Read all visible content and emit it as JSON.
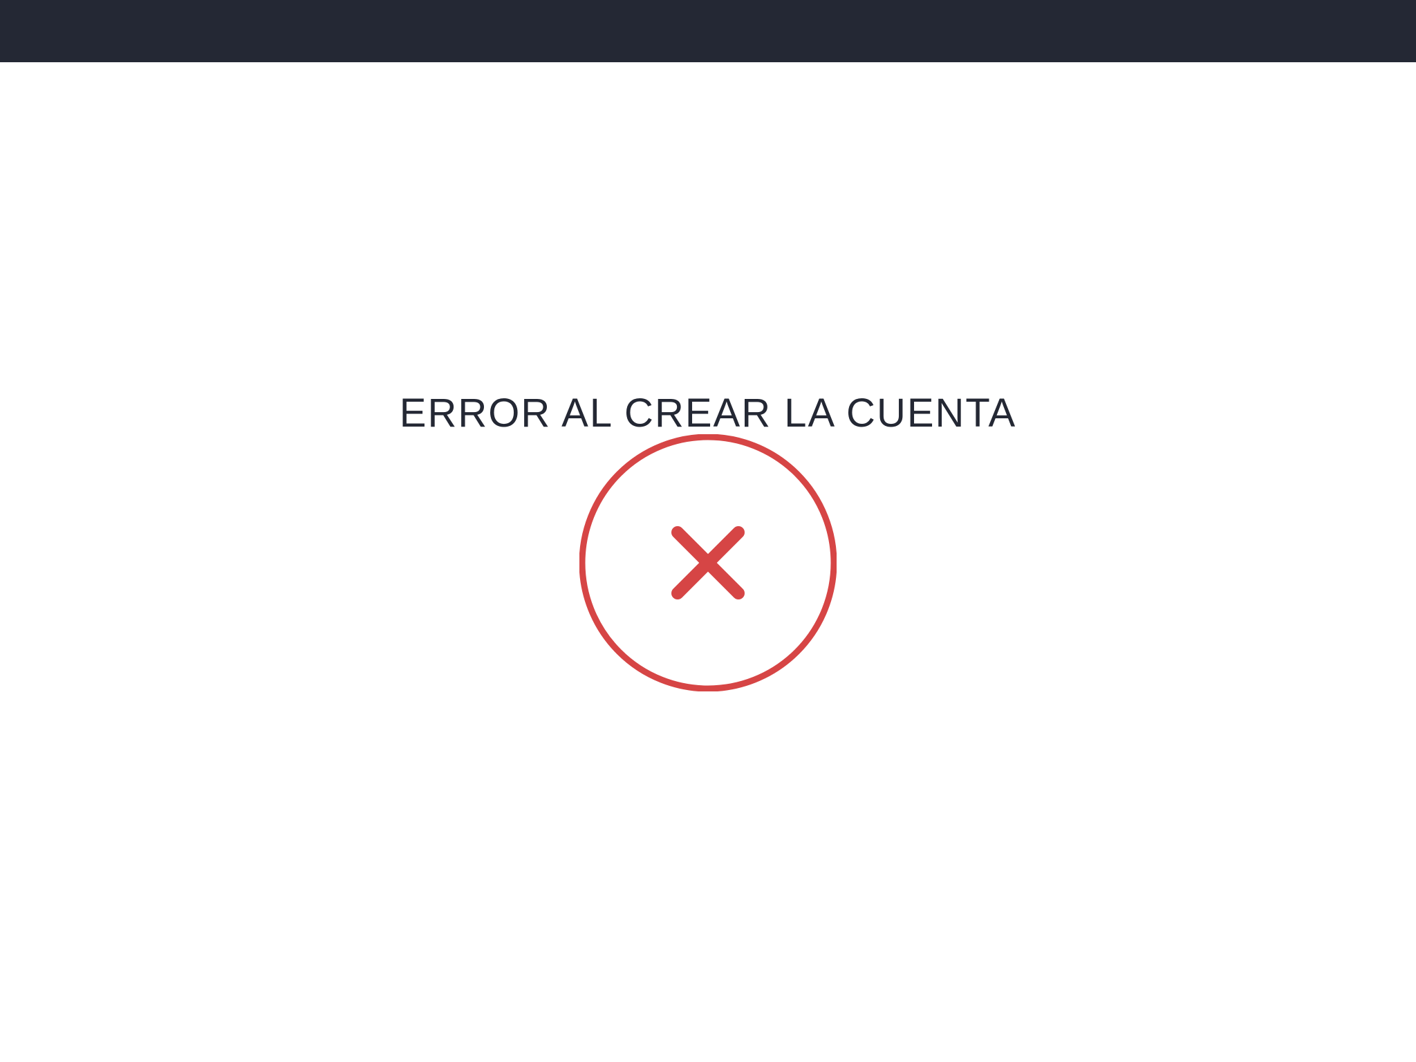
{
  "header": {
    "background_color": "#242834"
  },
  "message": {
    "title": "ERROR AL CREAR LA CUENTA",
    "text_color": "#242834"
  },
  "status_icon": {
    "name": "error-x-circle-icon",
    "color": "#D64545"
  }
}
